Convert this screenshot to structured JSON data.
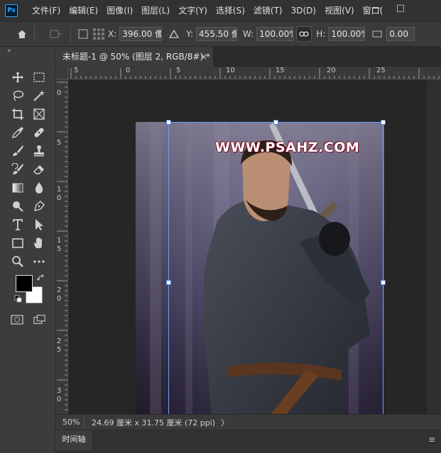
{
  "app": {
    "logo_text": "Ps"
  },
  "menu": [
    "文件(F)",
    "编辑(E)",
    "图像(I)",
    "图层(L)",
    "文字(Y)",
    "选择(S)",
    "滤镜(T)",
    "3D(D)",
    "视图(V)",
    "窗口("
  ],
  "window_controls": {
    "minimize": "—",
    "maximize": "□"
  },
  "options": {
    "x_label": "X:",
    "x_value": "396.00 像",
    "y_label": "Y:",
    "y_value": "455.50 像",
    "w_label": "W:",
    "w_value": "100.00%",
    "h_label": "H:",
    "h_value": "100.00%",
    "angle_value": "0.00"
  },
  "toolbar": {
    "collapse": "«"
  },
  "document": {
    "tab_title": "未标题-1 @ 50% (图层 2, RGB/8#) *",
    "tab_close": "×",
    "watermark": "WWW.PSAHZ.COM"
  },
  "rulers": {
    "h_labels": [
      "5",
      "0",
      "5",
      "10",
      "15",
      "20",
      "25"
    ],
    "v_labels": [
      "0",
      "5",
      "1",
      "0",
      "1",
      "5",
      "2",
      "0",
      "2",
      "5",
      "3",
      "0"
    ]
  },
  "status": {
    "zoom": "50%",
    "doc_size": "24.69 厘米 x 31.75 厘米 (72 ppi)",
    "arrow": "〉"
  },
  "timeline": {
    "label": "时间轴",
    "menu": "≡"
  }
}
